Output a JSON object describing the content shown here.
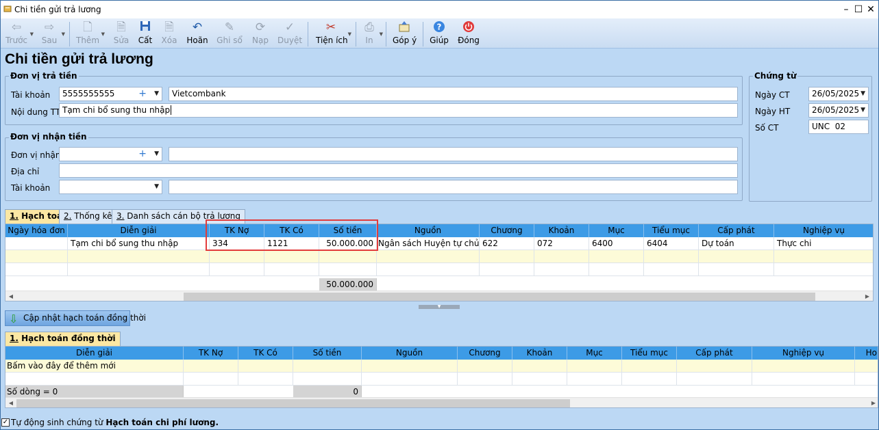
{
  "window": {
    "title": "Chi tiền gửi trả lương"
  },
  "toolbar": {
    "items": [
      {
        "label": "Trước",
        "icon": "arrow-left-icon",
        "enabled": false
      },
      {
        "label": "Sau",
        "icon": "arrow-right-icon",
        "enabled": false
      },
      {
        "label": "Thêm",
        "icon": "new-document-icon",
        "enabled": false
      },
      {
        "label": "Sửa",
        "icon": "edit-document-icon",
        "enabled": false
      },
      {
        "label": "Cất",
        "icon": "save-icon",
        "enabled": true
      },
      {
        "label": "Xóa",
        "icon": "delete-icon",
        "enabled": false
      },
      {
        "label": "Hoãn",
        "icon": "undo-icon",
        "enabled": true
      },
      {
        "label": "Ghi sổ",
        "icon": "pencil-icon",
        "enabled": false
      },
      {
        "label": "Nạp",
        "icon": "refresh-icon",
        "enabled": false
      },
      {
        "label": "Duyệt",
        "icon": "check-icon",
        "enabled": false
      },
      {
        "label": "Tiện ích",
        "icon": "tools-icon",
        "enabled": true
      },
      {
        "label": "In",
        "icon": "printer-icon",
        "enabled": false
      },
      {
        "label": "Góp ý",
        "icon": "feedback-icon",
        "enabled": true
      },
      {
        "label": "Giúp",
        "icon": "help-icon",
        "enabled": true
      },
      {
        "label": "Đóng",
        "icon": "power-icon",
        "enabled": true
      }
    ]
  },
  "page_title": "Chi tiền gửi trả lương",
  "payer": {
    "group_title": "Đơn vị trả tiền",
    "account_label": "Tài khoản",
    "account_value": "5555555555",
    "bank_value": "Vietcombank",
    "content_label": "Nội dung TT",
    "content_value": "Tạm chi bổ sung thu nhập"
  },
  "receiver": {
    "group_title": "Đơn vị nhận tiền",
    "unit_label": "Đơn vị nhận",
    "address_label": "Địa chỉ",
    "account_label": "Tài khoản"
  },
  "voucher": {
    "group_title": "Chứng từ",
    "date_ct_label": "Ngày CT",
    "date_ct_value": "26/05/2025",
    "date_ht_label": "Ngày HT",
    "date_ht_value": "26/05/2025",
    "number_label": "Số CT",
    "number_value": "UNC  02"
  },
  "tabs": [
    {
      "num": "1.",
      "label": " Hạch toán"
    },
    {
      "num": "2.",
      "label": " Thống kê"
    },
    {
      "num": "3.",
      "label": " Danh sách cán bộ trả lương"
    }
  ],
  "grid1": {
    "headers": [
      "Ngày hóa đơn",
      "Diễn giải",
      "TK Nợ",
      "TK Có",
      "Số tiền",
      "Nguồn",
      "Chương",
      "Khoản",
      "Mục",
      "Tiểu mục",
      "Cấp phát",
      "Nghiệp vụ"
    ],
    "rows": [
      [
        "",
        "Tạm chi bổ sung thu nhập",
        "334",
        "1121",
        "50.000.000",
        "Ngân sách Huyện tự chủ",
        "622",
        "072",
        "6400",
        "6404",
        "Dự toán",
        "Thực chi"
      ]
    ],
    "total": "50.000.000"
  },
  "update_button": "Cập nhật hạch toán đồng thời",
  "tab2": {
    "num": "1.",
    "label": " Hạch toán đồng thời"
  },
  "grid2": {
    "headers": [
      "Diễn giải",
      "TK Nợ",
      "TK Có",
      "Số tiền",
      "Nguồn",
      "Chương",
      "Khoản",
      "Mục",
      "Tiểu mục",
      "Cấp phát",
      "Nghiệp vụ",
      "Ho"
    ],
    "add_row_text": "Bấm vào đây để thêm mới",
    "row_count": "Số dòng = 0",
    "total": "0"
  },
  "footer": {
    "auto_prefix": "Tự động sinh chứng từ ",
    "auto_bold": "Hạch toán chi phí lương."
  }
}
